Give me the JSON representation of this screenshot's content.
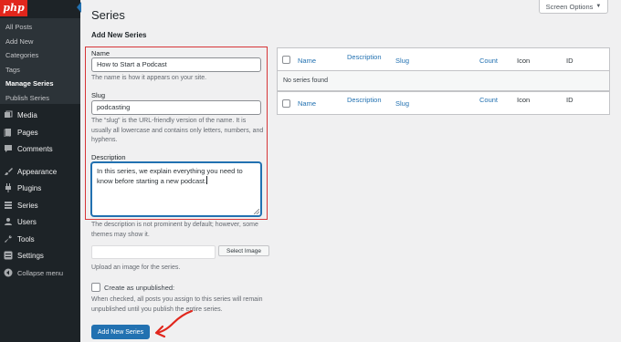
{
  "sidebar": {
    "logo_text": "php",
    "submenu": [
      {
        "label": "All Posts",
        "current": false
      },
      {
        "label": "Add New",
        "current": false
      },
      {
        "label": "Categories",
        "current": false
      },
      {
        "label": "Tags",
        "current": false
      },
      {
        "label": "Manage Series",
        "current": true
      },
      {
        "label": "Publish Series",
        "current": false
      }
    ],
    "menu": [
      {
        "label": "Media",
        "icon": "media-icon"
      },
      {
        "label": "Pages",
        "icon": "pages-icon"
      },
      {
        "label": "Comments",
        "icon": "comments-icon"
      },
      {
        "label": "Appearance",
        "icon": "appearance-icon"
      },
      {
        "label": "Plugins",
        "icon": "plugins-icon"
      },
      {
        "label": "Series",
        "icon": "series-icon"
      },
      {
        "label": "Users",
        "icon": "users-icon"
      },
      {
        "label": "Tools",
        "icon": "tools-icon"
      },
      {
        "label": "Settings",
        "icon": "settings-icon"
      },
      {
        "label": "Collapse menu",
        "icon": "collapse-icon"
      }
    ]
  },
  "header": {
    "title": "Series",
    "screen_options": "Screen Options"
  },
  "form": {
    "heading": "Add New Series",
    "name_label": "Name",
    "name_value": "How to Start a Podcast",
    "name_help": "The name is how it appears on your site.",
    "slug_label": "Slug",
    "slug_value": "podcasting",
    "slug_help": "The “slug” is the URL-friendly version of the name. It is usually all lowercase and contains only letters, numbers, and hyphens.",
    "description_label": "Description",
    "description_value": "In this series, we explain everything you need to know before starting a new podcast.",
    "description_help": "The description is not prominent by default; however, some themes may show it.",
    "select_image_label": "Select Image",
    "image_help": "Upload an image for the series.",
    "unpublished_label": "Create as unpublished:",
    "unpublished_help": "When checked, all posts you assign to this series will remain unpublished until you publish the entire series.",
    "submit_label": "Add New Series"
  },
  "table": {
    "columns": [
      "Name",
      "Description",
      "Slug",
      "Count",
      "Icon",
      "ID"
    ],
    "empty_message": "No series found"
  },
  "colors": {
    "accent": "#2271b1",
    "highlight": "#d63638",
    "sidebar_bg": "#1d2327"
  }
}
